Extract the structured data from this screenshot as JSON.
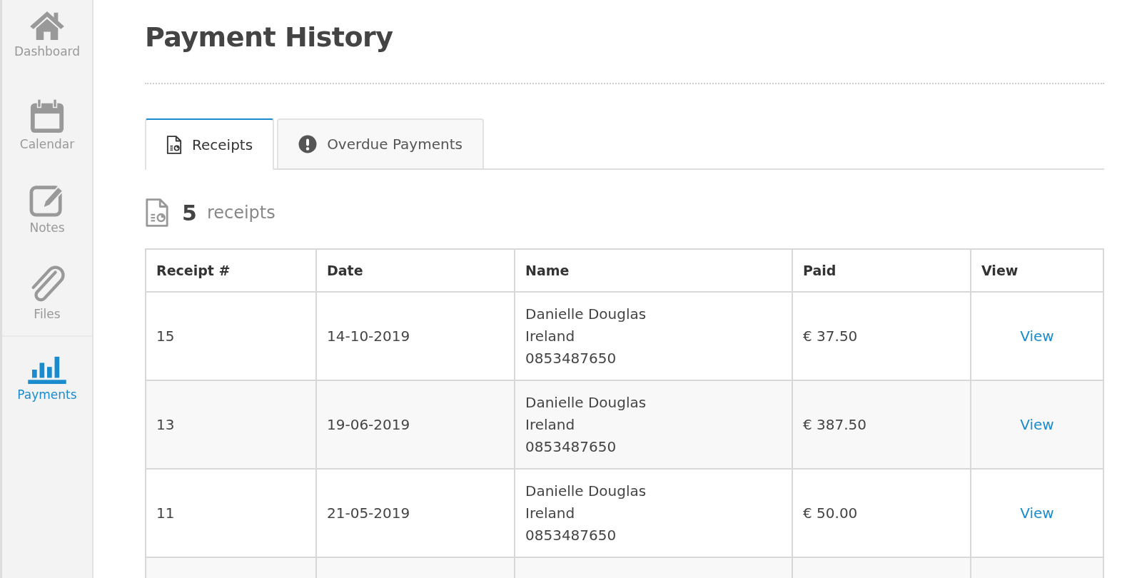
{
  "sidebar": {
    "items": [
      {
        "kind": "home",
        "label": "Dashboard",
        "selected": false
      },
      {
        "kind": "calendar",
        "label": "Calendar",
        "selected": false
      },
      {
        "kind": "notes",
        "label": "Notes",
        "selected": false
      },
      {
        "kind": "files",
        "label": "Files",
        "selected": false
      },
      {
        "kind": "payments",
        "label": "Payments",
        "selected": true
      }
    ]
  },
  "page_title": "Payment History",
  "tabs": [
    {
      "kind": "receipt",
      "label": "Receipts",
      "selected": true
    },
    {
      "kind": "alert",
      "label": "Overdue Payments",
      "selected": false
    }
  ],
  "summary": {
    "count": "5",
    "label": "receipts"
  },
  "table": {
    "columns": [
      "Receipt #",
      "Date",
      "Name",
      "Paid",
      "View"
    ],
    "rows": [
      {
        "receipt": "15",
        "date": "14-10-2019",
        "name": [
          "Danielle Douglas",
          "Ireland",
          "0853487650"
        ],
        "paid": "€ 37.50",
        "view": "View"
      },
      {
        "receipt": "13",
        "date": "19-06-2019",
        "name": [
          "Danielle Douglas",
          "Ireland",
          "0853487650"
        ],
        "paid": "€ 387.50",
        "view": "View"
      },
      {
        "receipt": "11",
        "date": "21-05-2019",
        "name": [
          "Danielle Douglas",
          "Ireland",
          "0853487650"
        ],
        "paid": "€ 50.00",
        "view": "View"
      }
    ]
  }
}
